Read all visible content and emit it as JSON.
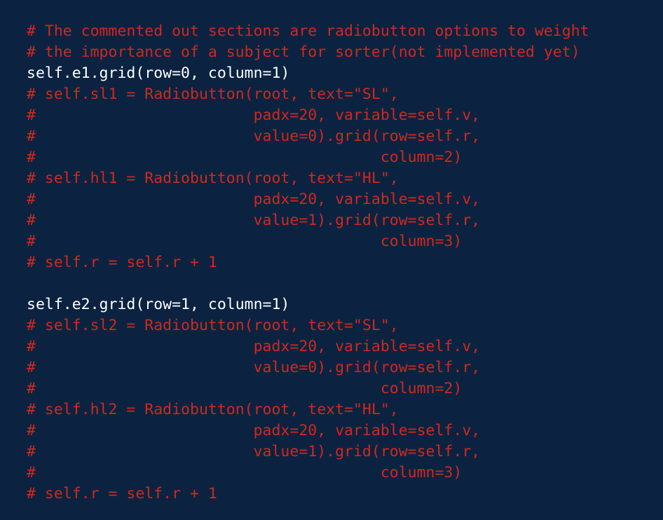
{
  "editor": {
    "background": "#0b2340",
    "comment_color": "#d1281f",
    "code_color": "#ffffff",
    "lines": [
      {
        "type": "comment",
        "text": "# The commented out sections are radiobutton options to weight"
      },
      {
        "type": "comment",
        "text": "# the importance of a subject for sorter(not implemented yet)"
      },
      {
        "type": "code",
        "text": "self.e1.grid(row=0, column=1)"
      },
      {
        "type": "comment",
        "text": "# self.sl1 = Radiobutton(root, text=\"SL\","
      },
      {
        "type": "comment",
        "text": "#                        padx=20, variable=self.v,"
      },
      {
        "type": "comment",
        "text": "#                        value=0).grid(row=self.r,"
      },
      {
        "type": "comment",
        "text": "#                                      column=2)"
      },
      {
        "type": "comment",
        "text": "# self.hl1 = Radiobutton(root, text=\"HL\","
      },
      {
        "type": "comment",
        "text": "#                        padx=20, variable=self.v,"
      },
      {
        "type": "comment",
        "text": "#                        value=1).grid(row=self.r,"
      },
      {
        "type": "comment",
        "text": "#                                      column=3)"
      },
      {
        "type": "comment",
        "text": "# self.r = self.r + 1"
      },
      {
        "type": "blank",
        "text": ""
      },
      {
        "type": "code",
        "text": "self.e2.grid(row=1, column=1)"
      },
      {
        "type": "comment",
        "text": "# self.sl2 = Radiobutton(root, text=\"SL\","
      },
      {
        "type": "comment",
        "text": "#                        padx=20, variable=self.v,"
      },
      {
        "type": "comment",
        "text": "#                        value=0).grid(row=self.r,"
      },
      {
        "type": "comment",
        "text": "#                                      column=2)"
      },
      {
        "type": "comment",
        "text": "# self.hl2 = Radiobutton(root, text=\"HL\","
      },
      {
        "type": "comment",
        "text": "#                        padx=20, variable=self.v,"
      },
      {
        "type": "comment",
        "text": "#                        value=1).grid(row=self.r,"
      },
      {
        "type": "comment",
        "text": "#                                      column=3)"
      },
      {
        "type": "comment",
        "text": "# self.r = self.r + 1"
      }
    ]
  }
}
